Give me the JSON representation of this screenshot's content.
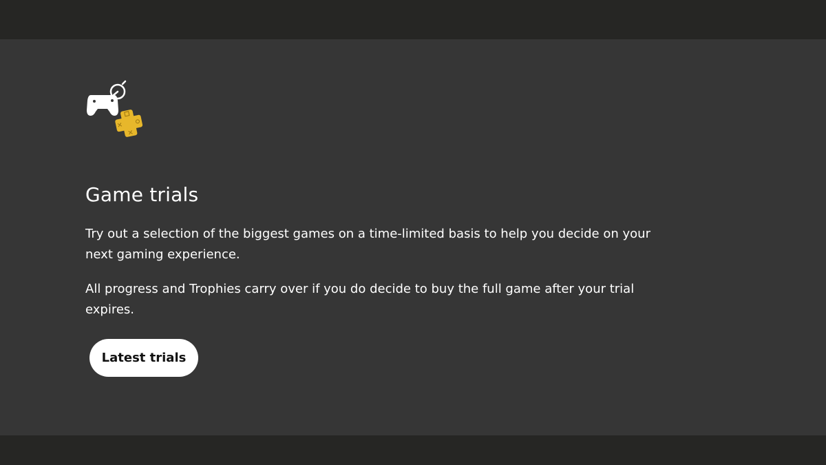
{
  "section": {
    "icon": "game-trial-plus-icon",
    "title": "Game trials",
    "paragraphs": [
      "Try out a selection of the biggest games on a time-limited basis to help you decide on your next gaming experience.",
      "All progress and Trophies carry over if you do decide to buy the full game after your trial expires."
    ],
    "cta_label": "Latest trials"
  },
  "colors": {
    "page_background": "#262624",
    "panel_background": "#363636",
    "plus_gold": "#e7b72b",
    "text": "#ffffff",
    "button_background": "#ffffff",
    "button_text": "#111111"
  }
}
